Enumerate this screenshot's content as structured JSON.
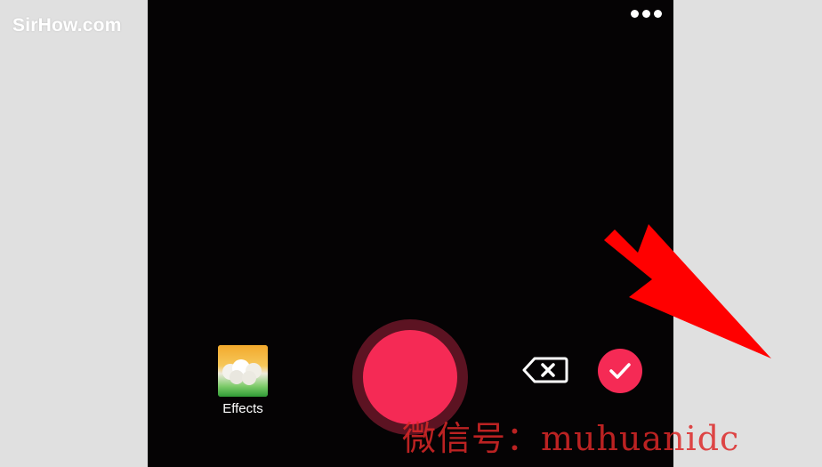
{
  "watermark": {
    "site": "SirHow.com",
    "wechat": "微信号：muhuanidc"
  },
  "toolbar": {
    "more_icon": "more-horizontal-icon"
  },
  "effects": {
    "label": "Effects"
  },
  "colors": {
    "record": "#f52a55",
    "background": "#050304",
    "arrow": "#ff0000"
  },
  "icons": {
    "delete": "backspace-x-icon",
    "confirm": "checkmark-icon"
  }
}
